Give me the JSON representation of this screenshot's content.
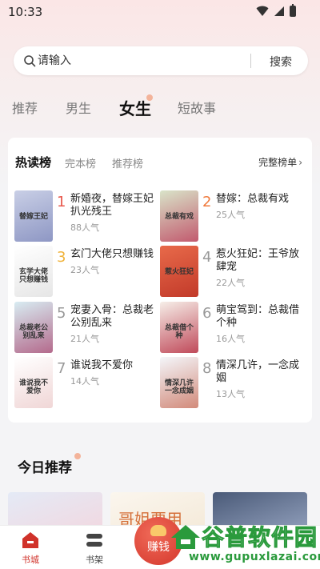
{
  "status_bar": {
    "time": "10:33"
  },
  "search": {
    "placeholder": "请输入",
    "button_label": "搜索"
  },
  "category_tabs": [
    {
      "label": "推荐",
      "active": false
    },
    {
      "label": "男生",
      "active": false
    },
    {
      "label": "女生",
      "active": true
    },
    {
      "label": "短故事",
      "active": false
    }
  ],
  "ranking": {
    "tabs": [
      {
        "label": "热读榜",
        "active": true
      },
      {
        "label": "完本榜",
        "active": false
      },
      {
        "label": "推荐榜",
        "active": false
      }
    ],
    "full_list_label": "完整榜单",
    "books": [
      {
        "rank": "1",
        "title": "新婚夜，替嫁王妃扒光残王",
        "popularity": "88人气",
        "cover_text": "替嫁王妃",
        "cover_colors": [
          "#c9cfe6",
          "#8e97c4"
        ],
        "rank_color": "#e8584c"
      },
      {
        "rank": "2",
        "title": "替嫁：总裁有戏",
        "popularity": "25人气",
        "cover_text": "总裁有戏",
        "cover_colors": [
          "#d9e4c9",
          "#c25a6e"
        ],
        "rank_color": "#f07a3c"
      },
      {
        "rank": "3",
        "title": "玄门大佬只想赚钱",
        "popularity": "23人气",
        "cover_text": "玄学大佬只想赚钱",
        "cover_colors": [
          "#ffffff",
          "#e6e6e6"
        ],
        "rank_color": "#f0b33c"
      },
      {
        "rank": "4",
        "title": "惹火狂妃：王爷放肆宠",
        "popularity": "22人气",
        "cover_text": "惹火狂妃",
        "cover_colors": [
          "#e86a4a",
          "#c23a2a"
        ],
        "rank_color": "#999999"
      },
      {
        "rank": "5",
        "title": "宠妻入骨：总裁老公别乱来",
        "popularity": "21人气",
        "cover_text": "总裁老公别乱来",
        "cover_colors": [
          "#d8ecf2",
          "#b46a8c"
        ],
        "rank_color": "#999999"
      },
      {
        "rank": "6",
        "title": "萌宝驾到：总裁借个种",
        "popularity": "16人气",
        "cover_text": "总裁借个种",
        "cover_colors": [
          "#f6eee8",
          "#c04a5a"
        ],
        "rank_color": "#999999"
      },
      {
        "rank": "7",
        "title": "谁说我不爱你",
        "popularity": "14人气",
        "cover_text": "谁说我不爱你",
        "cover_colors": [
          "#ffffff",
          "#f0d6d6"
        ],
        "rank_color": "#999999"
      },
      {
        "rank": "8",
        "title": "情深几许，一念成姻",
        "popularity": "13人气",
        "cover_text": "情深几许一念成姻",
        "cover_colors": [
          "#f4f6fa",
          "#d28a7a"
        ],
        "rank_color": "#999999"
      }
    ]
  },
  "today": {
    "title": "今日推荐",
    "covers": [
      {
        "colors": [
          "#e4eaf6",
          "#f3d6de"
        ]
      },
      {
        "colors": [
          "#fbf6ee",
          "#f3e8d6"
        ],
        "text": "哥姐要用"
      },
      {
        "colors": [
          "#4a5a78",
          "#9aa8c4"
        ]
      }
    ]
  },
  "bottom_nav": {
    "items": [
      {
        "label": "书城",
        "active": true
      },
      {
        "label": "书架",
        "active": false
      }
    ],
    "earn_label": "赚钱"
  },
  "watermark": {
    "text": "谷普软件园",
    "url": "www.gupuxlazai.com"
  },
  "colors": {
    "accent": "#d0322a",
    "dot": "#f3b39a"
  }
}
